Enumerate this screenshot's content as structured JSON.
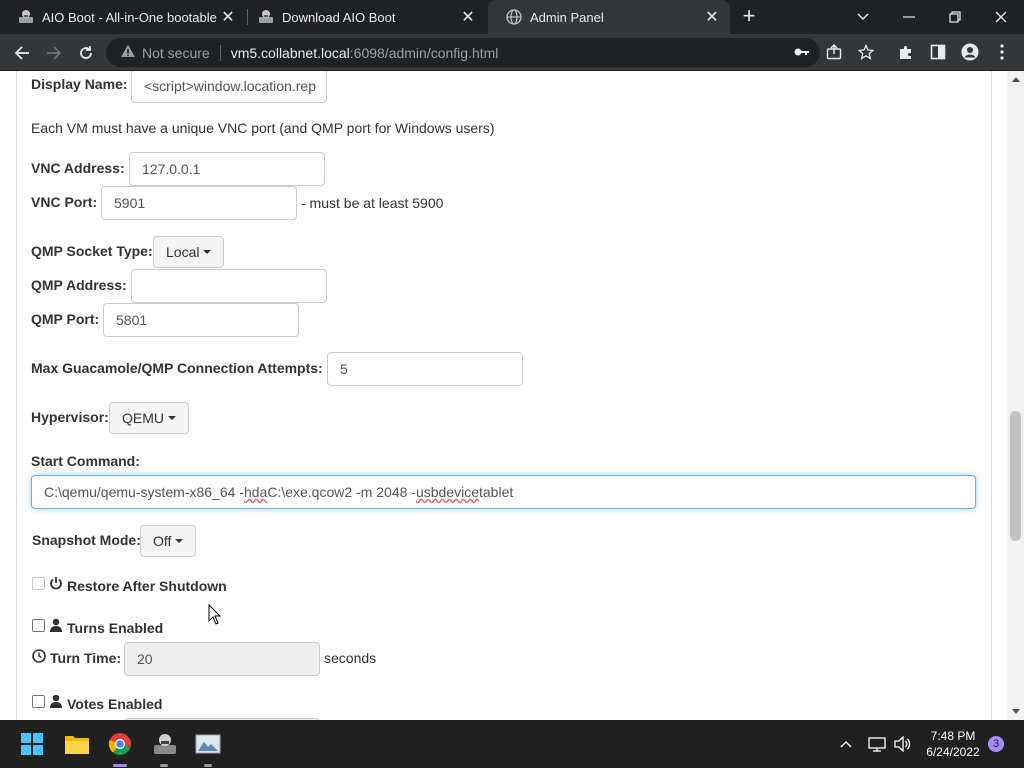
{
  "browser": {
    "tabs": [
      {
        "title": "AIO Boot - All-in-One bootable s",
        "active": false
      },
      {
        "title": "Download AIO Boot",
        "active": false
      },
      {
        "title": "Admin Panel",
        "active": true
      }
    ],
    "security_label": "Not secure",
    "url_host": "vm5.collabnet.local",
    "url_path": ":6098/admin/config.html"
  },
  "form": {
    "display_name_label": "Display Name:",
    "display_name_value": "<script>window.location.rep",
    "vnc_note": "Each VM must have a unique VNC port (and QMP port for Windows users)",
    "vnc_address_label": "VNC Address:",
    "vnc_address_value": "127.0.0.1",
    "vnc_port_label": "VNC Port:",
    "vnc_port_value": "5901",
    "vnc_port_hint": "- must be at least 5900",
    "qmp_socket_label": "QMP Socket Type:",
    "qmp_socket_value": "Local",
    "qmp_address_label": "QMP Address:",
    "qmp_address_value": "",
    "qmp_port_label": "QMP Port:",
    "qmp_port_value": "5801",
    "max_attempts_label": "Max Guacamole/QMP Connection Attempts:",
    "max_attempts_value": "5",
    "hypervisor_label": "Hypervisor:",
    "hypervisor_value": "QEMU",
    "start_command_label": "Start Command:",
    "start_command_parts": [
      "C:\\qemu/qemu-system-x86_64 -",
      "hda",
      " C:\\exe.qcow2 -m 2048 -",
      "usbdevice",
      " tablet"
    ],
    "snapshot_label": "Snapshot Mode:",
    "snapshot_value": "Off",
    "restore_label": "Restore After Shutdown",
    "turns_label": "Turns Enabled",
    "turn_time_label": "Turn Time:",
    "turn_time_value": "20",
    "turn_time_unit": "seconds",
    "votes_label": "Votes Enabled"
  },
  "taskbar": {
    "time": "7:48 PM",
    "date": "6/24/2022",
    "notification_count": "3"
  }
}
